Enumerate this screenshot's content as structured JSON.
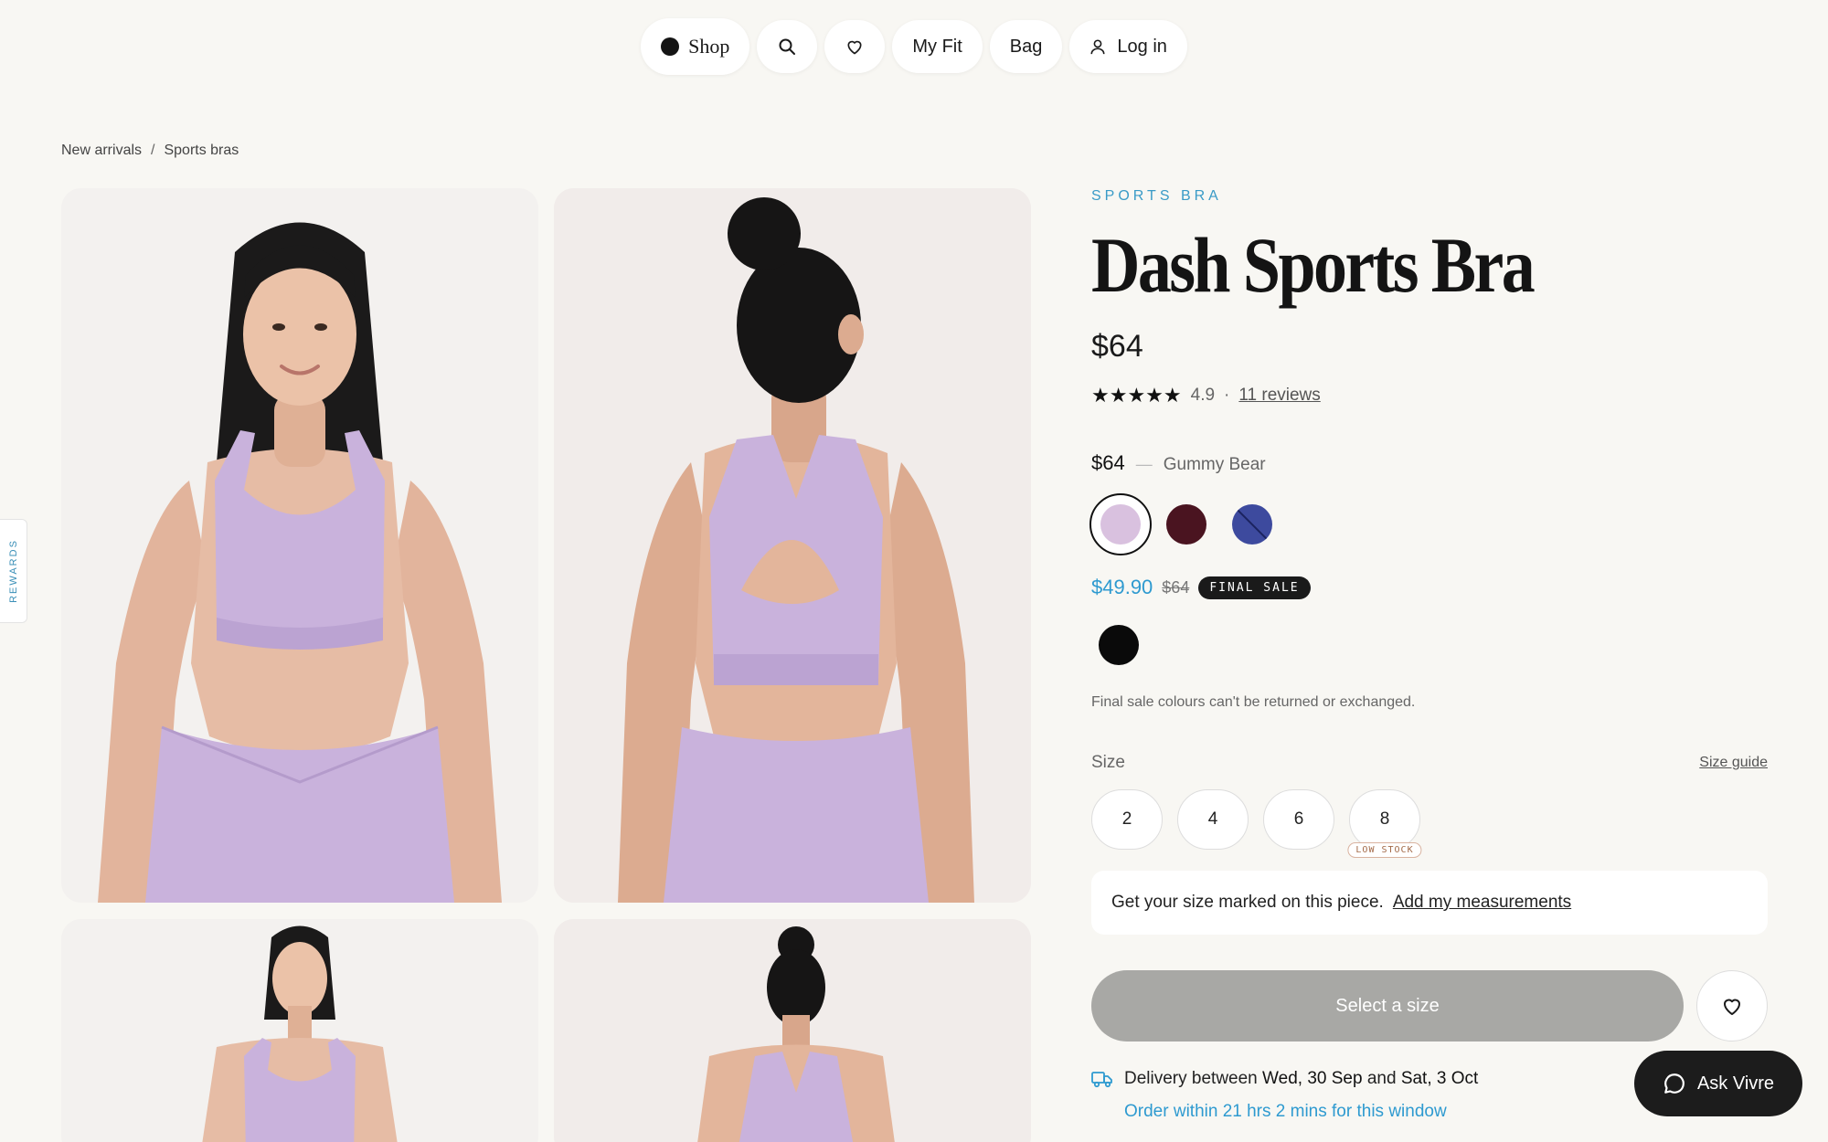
{
  "nav": {
    "shop_label": "Shop",
    "fit_label": "My Fit",
    "bag_label": "Bag",
    "login_label": "Log in",
    "icons": [
      "search-icon",
      "heart-icon",
      "user-icon"
    ]
  },
  "breadcrumb": {
    "items": [
      "New arrivals",
      "Sports bras"
    ],
    "separator": "/"
  },
  "rewards_tab": "REWARDS",
  "product": {
    "eyebrow": "SPORTS BRA",
    "title": "Dash Sports Bra",
    "price": "$64",
    "rating_value": "4.9",
    "rating_sep": "·",
    "reviews_label": "11 reviews",
    "stars": "★★★★★"
  },
  "variant": {
    "price": "$64",
    "dash": "—",
    "selected_colour": "Gummy Bear",
    "swatches": [
      {
        "color": "#d9c1df",
        "selected": true
      },
      {
        "color": "#4a1420",
        "selected": false
      },
      {
        "color": "#3d4a9e",
        "selected": false,
        "unavailable": true
      }
    ]
  },
  "sale": {
    "price": "$49.90",
    "old_price": "$64",
    "badge": "FINAL SALE",
    "swatch_color": "#0a0a0a",
    "note": "Final sale colours can't be returned or exchanged."
  },
  "size": {
    "label": "Size",
    "guide_label": "Size guide",
    "options": [
      "2",
      "4",
      "6",
      "8"
    ],
    "low_stock_label": "LOW STOCK"
  },
  "measurements": {
    "text": "Get your size marked on this piece.",
    "link": "Add my measurements"
  },
  "cta": {
    "label": "Select a size"
  },
  "delivery": {
    "prefix": "Delivery between ",
    "start": "Wed, 30 Sep",
    "mid": " and ",
    "end": "Sat, 3 Oct",
    "order_window": "Order within 21 hrs 2 mins for this window"
  },
  "chat": {
    "label": "Ask Vivre"
  },
  "colors": {
    "accent": "#2e9ad0",
    "background": "#f8f7f3",
    "cta_disabled": "#a8a8a5"
  }
}
